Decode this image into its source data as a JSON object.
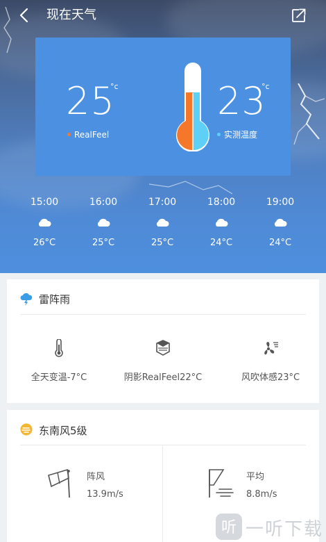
{
  "header": {
    "title": "现在天气"
  },
  "temperature": {
    "realfeel_value": "25",
    "realfeel_unit": "°c",
    "realfeel_label": "RealFeel",
    "measured_value": "23",
    "measured_unit": "°c",
    "measured_label": "实测温度",
    "colors": {
      "realfeel": "#f5782a",
      "measured": "#5ed0f5"
    }
  },
  "hourly": [
    {
      "time": "15:00",
      "icon": "cloud-icon",
      "temp": "26°C"
    },
    {
      "time": "16:00",
      "icon": "cloud-icon",
      "temp": "25°C"
    },
    {
      "time": "17:00",
      "icon": "cloud-icon",
      "temp": "25°C"
    },
    {
      "time": "18:00",
      "icon": "cloud-icon",
      "temp": "24°C"
    },
    {
      "time": "19:00",
      "icon": "cloud-icon",
      "temp": "24°C"
    }
  ],
  "condition_card": {
    "title": "雷阵雨",
    "items": [
      {
        "icon": "thermometer-icon",
        "label": "全天变温-7°C"
      },
      {
        "icon": "shade-icon",
        "label": "阴影RealFeel22°C"
      },
      {
        "icon": "wind-chill-icon",
        "label": "风吹体感23°C"
      }
    ]
  },
  "wind_card": {
    "title": "东南风5级",
    "gust": {
      "label": "阵风",
      "value": "13.9m/s"
    },
    "average": {
      "label": "平均",
      "value": "8.8m/s"
    }
  },
  "watermark": {
    "text": "一听下载"
  }
}
